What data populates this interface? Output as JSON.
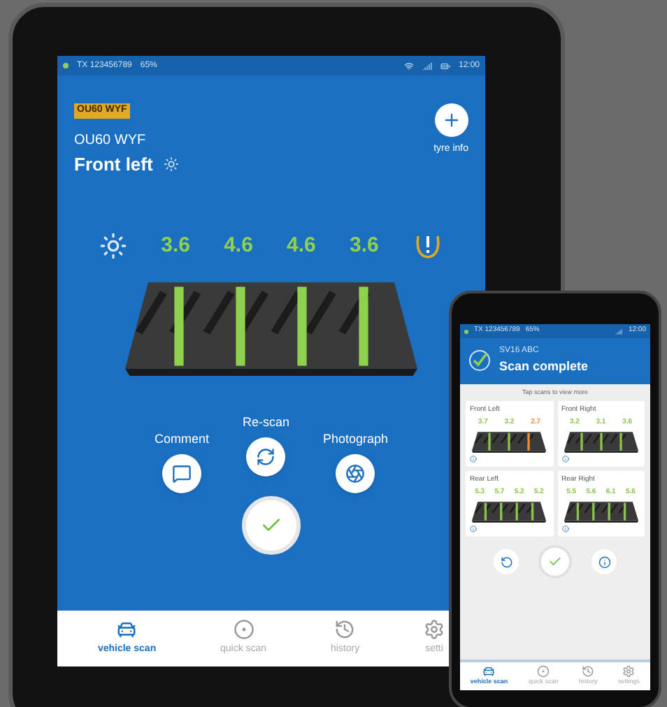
{
  "tablet": {
    "status_bar": {
      "id": "TX 123456789",
      "battery": "65%",
      "time": "12:00"
    },
    "vehicle": {
      "plate_badge": "OU60 WYF",
      "registration": "OU60 WYF",
      "position": "Front left"
    },
    "tyre_info": {
      "label": "tyre info"
    },
    "readings": [
      {
        "value": "3.6",
        "color": "#8fd14f"
      },
      {
        "value": "4.6",
        "color": "#8fd14f"
      },
      {
        "value": "4.6",
        "color": "#8fd14f"
      },
      {
        "value": "3.6",
        "color": "#8fd14f"
      }
    ],
    "actions": [
      {
        "kind": "comment",
        "label": "Comment"
      },
      {
        "kind": "rescan",
        "label": "Re-scan"
      },
      {
        "kind": "photograph",
        "label": "Photograph"
      }
    ],
    "nav": [
      {
        "kind": "vehicle",
        "label": "vehicle scan",
        "selected": true
      },
      {
        "kind": "quick",
        "label": "quick scan",
        "selected": false
      },
      {
        "kind": "history",
        "label": "history",
        "selected": false
      },
      {
        "kind": "settings",
        "label": "setti",
        "selected": false
      }
    ]
  },
  "phone": {
    "status_bar": {
      "id": "TX 123456789",
      "battery": "65%",
      "time": "12:00"
    },
    "registration": "SV16 ABC",
    "title": "Scan complete",
    "hint": "Tap scans to view more",
    "cards": [
      {
        "position": "Front Left",
        "readings": [
          {
            "value": "3.7",
            "color": "#8bc34a"
          },
          {
            "value": "3.2",
            "color": "#8bc34a"
          },
          {
            "value": "2.7",
            "color": "#f28c28"
          }
        ]
      },
      {
        "position": "Front Right",
        "readings": [
          {
            "value": "3.2",
            "color": "#8bc34a"
          },
          {
            "value": "3.1",
            "color": "#8bc34a"
          },
          {
            "value": "3.6",
            "color": "#8bc34a"
          }
        ]
      },
      {
        "position": "Rear Left",
        "readings": [
          {
            "value": "5.3",
            "color": "#8bc34a"
          },
          {
            "value": "5.7",
            "color": "#8bc34a"
          },
          {
            "value": "5.2",
            "color": "#8bc34a"
          },
          {
            "value": "5.2",
            "color": "#8bc34a"
          }
        ]
      },
      {
        "position": "Rear Right",
        "readings": [
          {
            "value": "5.5",
            "color": "#8bc34a"
          },
          {
            "value": "5.6",
            "color": "#8bc34a"
          },
          {
            "value": "6.1",
            "color": "#8bc34a"
          },
          {
            "value": "5.6",
            "color": "#8bc34a"
          }
        ]
      }
    ],
    "nav": [
      {
        "kind": "vehicle",
        "label": "vehicle scan",
        "selected": true
      },
      {
        "kind": "quick",
        "label": "quick scan",
        "selected": false
      },
      {
        "kind": "history",
        "label": "history",
        "selected": false
      },
      {
        "kind": "settings",
        "label": "settings",
        "selected": false
      }
    ]
  }
}
